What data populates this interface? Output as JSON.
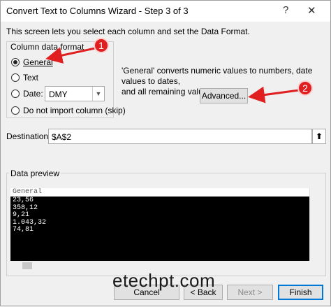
{
  "window": {
    "title": "Convert Text to Columns Wizard - Step 3 of 3",
    "help_glyph": "?",
    "close_glyph": "✕"
  },
  "intro_text": "This screen lets you select each column and set the Data Format.",
  "column_format": {
    "legend": "Column data format",
    "options": [
      {
        "label": "General",
        "checked": true
      },
      {
        "label": "Text",
        "checked": false
      },
      {
        "label": "Date:",
        "checked": false
      },
      {
        "label": "Do not import column (skip)",
        "checked": false
      }
    ],
    "date_select": {
      "value": "DMY"
    }
  },
  "info": {
    "line1": "'General' converts numeric values to numbers, date values to dates,",
    "line2": "and all remaining values to text."
  },
  "advanced_button": "Advanced...",
  "destination": {
    "label": "Destination:",
    "value": "$A$2"
  },
  "preview": {
    "label": "Data preview",
    "header": "General",
    "rows": [
      "23,56",
      "358,12",
      "9,21",
      "1.043,32",
      "74,81"
    ]
  },
  "buttons": {
    "cancel": "Cancel",
    "back": "< Back",
    "next": "Next >",
    "finish": "Finish"
  },
  "callouts": {
    "one": "1",
    "two": "2"
  },
  "watermark": "etechpt.com",
  "colors": {
    "callout": "#e02020",
    "preview_bg": "#000000",
    "finish_border": "#0078d7"
  }
}
